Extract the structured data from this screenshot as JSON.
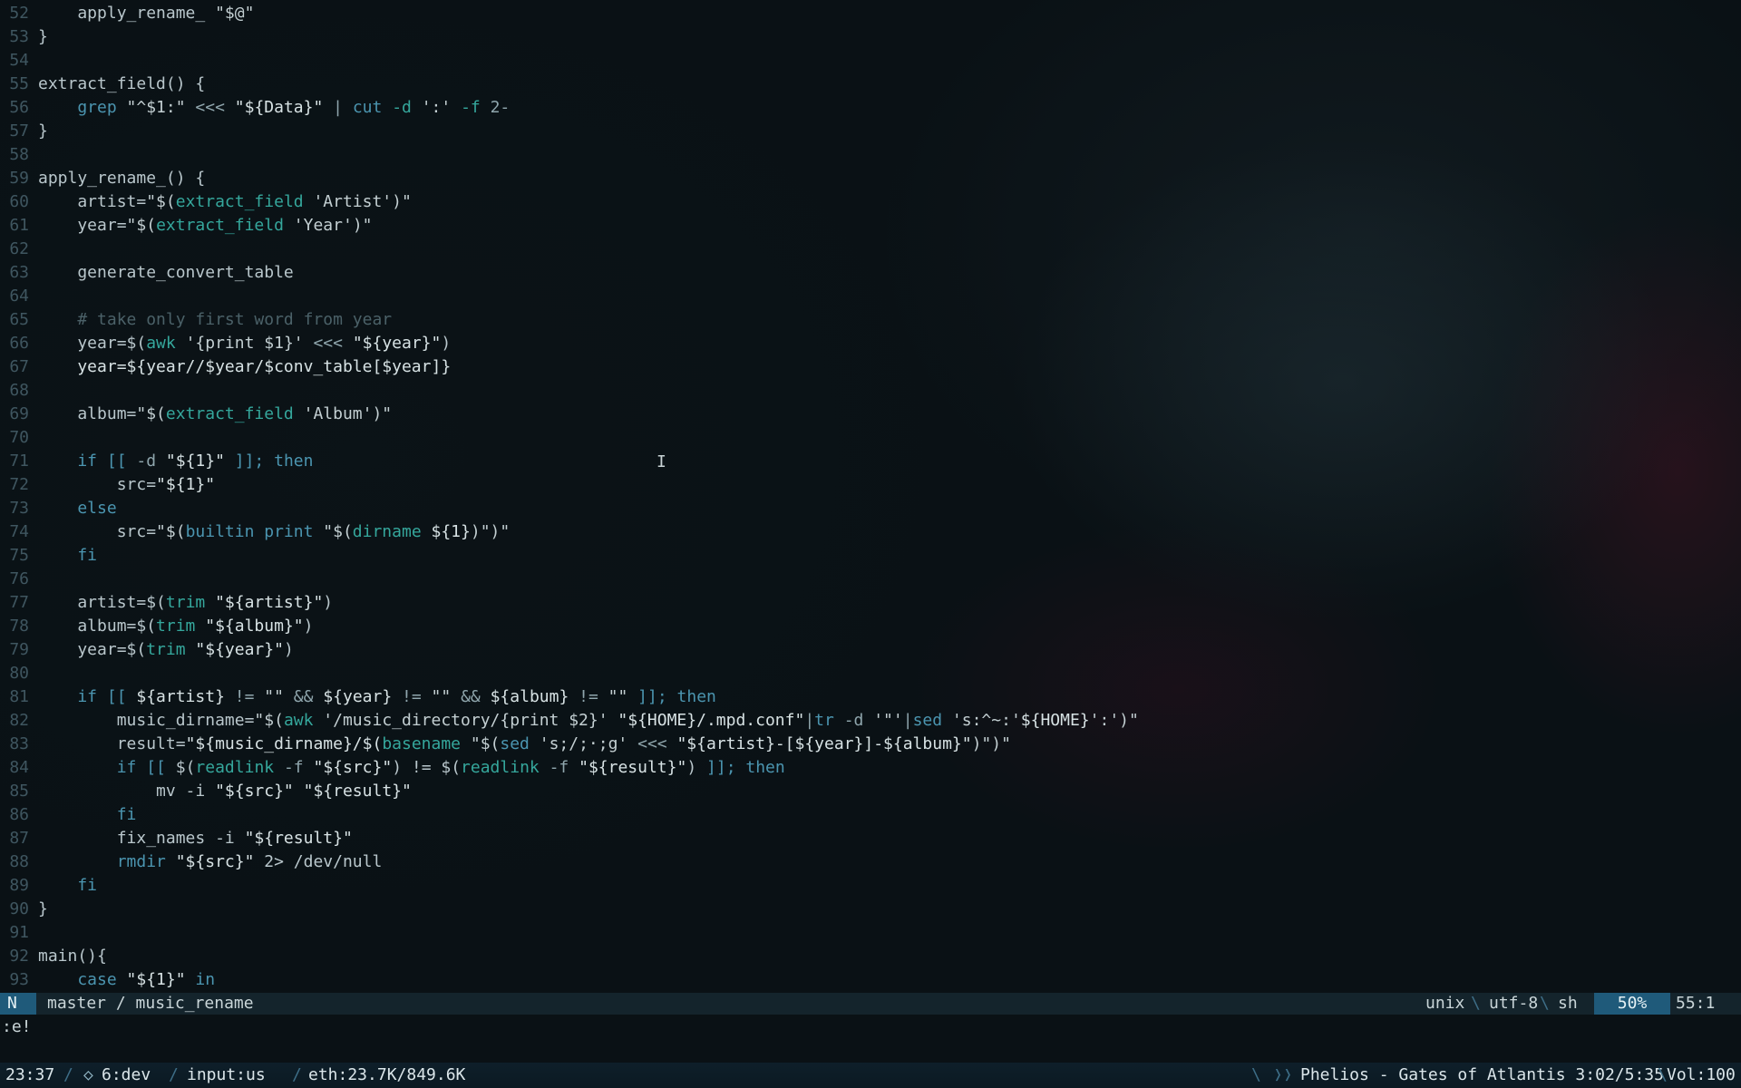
{
  "editor": {
    "lines": [
      {
        "n": "52",
        "segs": [
          {
            "t": "    apply_rename_ ",
            "c": "plain"
          },
          {
            "t": "\"$@\"",
            "c": "str"
          }
        ]
      },
      {
        "n": "53",
        "segs": [
          {
            "t": "}",
            "c": "plain"
          }
        ]
      },
      {
        "n": "54",
        "segs": []
      },
      {
        "n": "55",
        "segs": [
          {
            "t": "extract_field() {",
            "c": "plain"
          }
        ]
      },
      {
        "n": "56",
        "segs": [
          {
            "t": "    grep ",
            "c": "kw"
          },
          {
            "t": "\"^$1:\"",
            "c": "str"
          },
          {
            "t": " <<< ",
            "c": "op"
          },
          {
            "t": "\"${Data}\"",
            "c": "var"
          },
          {
            "t": " | ",
            "c": "op"
          },
          {
            "t": "cut ",
            "c": "kw"
          },
          {
            "t": "-d ",
            "c": "fn"
          },
          {
            "t": "':' ",
            "c": "str"
          },
          {
            "t": "-f ",
            "c": "fn"
          },
          {
            "t": "2-",
            "c": "op"
          }
        ]
      },
      {
        "n": "57",
        "segs": [
          {
            "t": "}",
            "c": "plain"
          }
        ]
      },
      {
        "n": "58",
        "segs": []
      },
      {
        "n": "59",
        "segs": [
          {
            "t": "apply_rename_() {",
            "c": "plain"
          }
        ]
      },
      {
        "n": "60",
        "segs": [
          {
            "t": "    artist=",
            "c": "plain"
          },
          {
            "t": "\"$(",
            "c": "str"
          },
          {
            "t": "extract_field ",
            "c": "fn"
          },
          {
            "t": "'Artist'",
            "c": "str"
          },
          {
            "t": ")\"",
            "c": "str"
          }
        ]
      },
      {
        "n": "61",
        "segs": [
          {
            "t": "    year=",
            "c": "plain"
          },
          {
            "t": "\"$(",
            "c": "str"
          },
          {
            "t": "extract_field ",
            "c": "fn"
          },
          {
            "t": "'Year'",
            "c": "str"
          },
          {
            "t": ")\"",
            "c": "str"
          }
        ]
      },
      {
        "n": "62",
        "segs": []
      },
      {
        "n": "63",
        "segs": [
          {
            "t": "    generate_convert_table",
            "c": "plain"
          }
        ]
      },
      {
        "n": "64",
        "segs": []
      },
      {
        "n": "65",
        "segs": [
          {
            "t": "    # take only first word from year",
            "c": "cmt"
          }
        ]
      },
      {
        "n": "66",
        "segs": [
          {
            "t": "    year=$(",
            "c": "plain"
          },
          {
            "t": "awk ",
            "c": "fn"
          },
          {
            "t": "'{print $1}'",
            "c": "str"
          },
          {
            "t": " <<< ",
            "c": "op"
          },
          {
            "t": "\"${year}\"",
            "c": "var"
          },
          {
            "t": ")",
            "c": "plain"
          }
        ]
      },
      {
        "n": "67",
        "segs": [
          {
            "t": "    year=${year//$year/$conv_table[$year]}",
            "c": "var"
          }
        ]
      },
      {
        "n": "68",
        "segs": []
      },
      {
        "n": "69",
        "segs": [
          {
            "t": "    album=",
            "c": "plain"
          },
          {
            "t": "\"$(",
            "c": "str"
          },
          {
            "t": "extract_field ",
            "c": "fn"
          },
          {
            "t": "'Album'",
            "c": "str"
          },
          {
            "t": ")\"",
            "c": "str"
          }
        ]
      },
      {
        "n": "70",
        "segs": []
      },
      {
        "n": "71",
        "segs": [
          {
            "t": "    if ",
            "c": "kw"
          },
          {
            "t": "[[ ",
            "c": "kw"
          },
          {
            "t": "-d ",
            "c": "op"
          },
          {
            "t": "\"${1}\"",
            "c": "var"
          },
          {
            "t": " ]]; ",
            "c": "kw"
          },
          {
            "t": "then",
            "c": "kw"
          }
        ]
      },
      {
        "n": "72",
        "segs": [
          {
            "t": "        src=",
            "c": "plain"
          },
          {
            "t": "\"${1}\"",
            "c": "var"
          }
        ]
      },
      {
        "n": "73",
        "segs": [
          {
            "t": "    else",
            "c": "kw"
          }
        ]
      },
      {
        "n": "74",
        "segs": [
          {
            "t": "        src=",
            "c": "plain"
          },
          {
            "t": "\"$(",
            "c": "str"
          },
          {
            "t": "builtin print ",
            "c": "kw"
          },
          {
            "t": "\"$(",
            "c": "str"
          },
          {
            "t": "dirname ",
            "c": "fn"
          },
          {
            "t": "${1}",
            "c": "var"
          },
          {
            "t": ")\")\"",
            "c": "str"
          }
        ]
      },
      {
        "n": "75",
        "segs": [
          {
            "t": "    fi",
            "c": "kw"
          }
        ]
      },
      {
        "n": "76",
        "segs": []
      },
      {
        "n": "77",
        "segs": [
          {
            "t": "    artist=$(",
            "c": "plain"
          },
          {
            "t": "trim ",
            "c": "fn"
          },
          {
            "t": "\"${artist}\"",
            "c": "var"
          },
          {
            "t": ")",
            "c": "plain"
          }
        ]
      },
      {
        "n": "78",
        "segs": [
          {
            "t": "    album=$(",
            "c": "plain"
          },
          {
            "t": "trim ",
            "c": "fn"
          },
          {
            "t": "\"${album}\"",
            "c": "var"
          },
          {
            "t": ")",
            "c": "plain"
          }
        ]
      },
      {
        "n": "79",
        "segs": [
          {
            "t": "    year=$(",
            "c": "plain"
          },
          {
            "t": "trim ",
            "c": "fn"
          },
          {
            "t": "\"${year}\"",
            "c": "var"
          },
          {
            "t": ")",
            "c": "plain"
          }
        ]
      },
      {
        "n": "80",
        "segs": []
      },
      {
        "n": "81",
        "segs": [
          {
            "t": "    if ",
            "c": "kw"
          },
          {
            "t": "[[ ",
            "c": "kw"
          },
          {
            "t": "${artist}",
            "c": "var"
          },
          {
            "t": " != ",
            "c": "op"
          },
          {
            "t": "\"\"",
            "c": "str"
          },
          {
            "t": " && ",
            "c": "op"
          },
          {
            "t": "${year}",
            "c": "var"
          },
          {
            "t": " != ",
            "c": "op"
          },
          {
            "t": "\"\"",
            "c": "str"
          },
          {
            "t": " && ",
            "c": "op"
          },
          {
            "t": "${album}",
            "c": "var"
          },
          {
            "t": " != ",
            "c": "op"
          },
          {
            "t": "\"\"",
            "c": "str"
          },
          {
            "t": " ]]; ",
            "c": "kw"
          },
          {
            "t": "then",
            "c": "kw"
          }
        ]
      },
      {
        "n": "82",
        "segs": [
          {
            "t": "        music_dirname=",
            "c": "plain"
          },
          {
            "t": "\"$(",
            "c": "str"
          },
          {
            "t": "awk ",
            "c": "fn"
          },
          {
            "t": "'/music_directory/{print $2}'",
            "c": "str"
          },
          {
            "t": " \"${HOME}/.mpd.conf\"",
            "c": "var"
          },
          {
            "t": "|",
            "c": "op"
          },
          {
            "t": "tr ",
            "c": "kw"
          },
          {
            "t": "-d ",
            "c": "op"
          },
          {
            "t": "'\"'",
            "c": "str"
          },
          {
            "t": "|",
            "c": "op"
          },
          {
            "t": "sed ",
            "c": "kw"
          },
          {
            "t": "'s:^~:'",
            "c": "str"
          },
          {
            "t": "${HOME}",
            "c": "var"
          },
          {
            "t": "':'",
            "c": "str"
          },
          {
            "t": ")\"",
            "c": "str"
          }
        ]
      },
      {
        "n": "83",
        "segs": [
          {
            "t": "        result=",
            "c": "plain"
          },
          {
            "t": "\"${music_dirname}/$(",
            "c": "var"
          },
          {
            "t": "basename ",
            "c": "fn"
          },
          {
            "t": "\"$(",
            "c": "str"
          },
          {
            "t": "sed ",
            "c": "kw"
          },
          {
            "t": "'s;/;·;g'",
            "c": "str"
          },
          {
            "t": " <<< ",
            "c": "op"
          },
          {
            "t": "\"${artist}-[${year}]-${album}\"",
            "c": "var"
          },
          {
            "t": ")\")\"",
            "c": "str"
          }
        ]
      },
      {
        "n": "84",
        "segs": [
          {
            "t": "        if ",
            "c": "kw"
          },
          {
            "t": "[[ ",
            "c": "kw"
          },
          {
            "t": "$(",
            "c": "plain"
          },
          {
            "t": "readlink ",
            "c": "fn"
          },
          {
            "t": "-f ",
            "c": "op"
          },
          {
            "t": "\"${src}\"",
            "c": "var"
          },
          {
            "t": ") != $(",
            "c": "plain"
          },
          {
            "t": "readlink ",
            "c": "fn"
          },
          {
            "t": "-f ",
            "c": "op"
          },
          {
            "t": "\"${result}\"",
            "c": "var"
          },
          {
            "t": ") ",
            "c": "plain"
          },
          {
            "t": "]]; then",
            "c": "kw"
          }
        ]
      },
      {
        "n": "85",
        "segs": [
          {
            "t": "            mv -i ",
            "c": "plain"
          },
          {
            "t": "\"${src}\"",
            "c": "var"
          },
          {
            "t": " ",
            "c": "plain"
          },
          {
            "t": "\"${result}\"",
            "c": "var"
          }
        ]
      },
      {
        "n": "86",
        "segs": [
          {
            "t": "        fi",
            "c": "kw"
          }
        ]
      },
      {
        "n": "87",
        "segs": [
          {
            "t": "        fix_names -i ",
            "c": "plain"
          },
          {
            "t": "\"${result}\"",
            "c": "var"
          }
        ]
      },
      {
        "n": "88",
        "segs": [
          {
            "t": "        rmdir ",
            "c": "kw"
          },
          {
            "t": "\"${src}\"",
            "c": "var"
          },
          {
            "t": " 2> /dev/null",
            "c": "plain"
          }
        ]
      },
      {
        "n": "89",
        "segs": [
          {
            "t": "    fi",
            "c": "kw"
          }
        ]
      },
      {
        "n": "90",
        "segs": [
          {
            "t": "}",
            "c": "plain"
          }
        ]
      },
      {
        "n": "91",
        "segs": []
      },
      {
        "n": "92",
        "segs": [
          {
            "t": "main(){",
            "c": "plain"
          }
        ]
      },
      {
        "n": "93",
        "segs": [
          {
            "t": "    case ",
            "c": "kw"
          },
          {
            "t": "\"${1}\"",
            "c": "var"
          },
          {
            "t": " in",
            "c": "kw"
          }
        ]
      }
    ]
  },
  "statusline": {
    "mode": "N",
    "branch": "master / music_rename",
    "fileformat": "unix",
    "encoding": "utf-8",
    "filetype": "sh",
    "percent": "50%",
    "position": "55:1"
  },
  "cmdline": ":e!",
  "bar": {
    "time": "23:37",
    "workspace_icon": "◇",
    "workspace": "6:dev",
    "input": "input:us",
    "net": "eth:23.7K/849.6K",
    "now_playing": "Phelios - Gates of Atlantis 3:02/5:35",
    "volume": "Vol:100"
  },
  "colors": {
    "keyword": "#4b95b0",
    "function": "#35a79c",
    "comment": "#4b6168",
    "mode_bg": "#1f5a7a"
  }
}
